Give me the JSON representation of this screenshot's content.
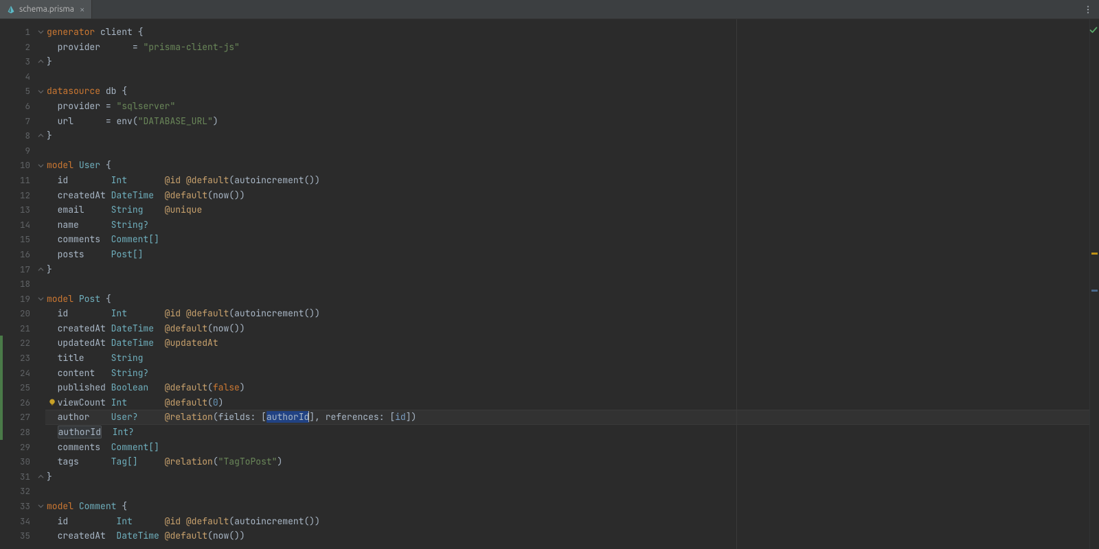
{
  "tab": {
    "filename": "schema.prisma"
  },
  "gutter": {
    "start": 1,
    "end": 35
  },
  "fold": {
    "1": "open",
    "3": "close",
    "5": "open",
    "8": "close",
    "10": "open",
    "17": "close",
    "19": "open",
    "31": "close",
    "33": "open"
  },
  "changes": {
    "22": "mod",
    "23": "mod",
    "24": "mod",
    "25": "mod",
    "26": "mod",
    "27": "mod",
    "28": "mod"
  },
  "cursor_line": 27,
  "intention_bulb_line": 26,
  "code": {
    "1": [
      [
        "kw",
        "generator"
      ],
      [
        "sp",
        " "
      ],
      [
        "id",
        "client"
      ],
      [
        "sp",
        " "
      ],
      [
        "pun",
        "{"
      ]
    ],
    "2": [
      [
        "sp",
        "  "
      ],
      [
        "id",
        "provider"
      ],
      [
        "sp",
        "      "
      ],
      [
        "pun",
        "= "
      ],
      [
        "str",
        "\"prisma-client-js\""
      ]
    ],
    "3": [
      [
        "pun",
        "}"
      ]
    ],
    "4": [],
    "5": [
      [
        "kw",
        "datasource"
      ],
      [
        "sp",
        " "
      ],
      [
        "id",
        "db"
      ],
      [
        "sp",
        " "
      ],
      [
        "pun",
        "{"
      ]
    ],
    "6": [
      [
        "sp",
        "  "
      ],
      [
        "id",
        "provider"
      ],
      [
        "sp",
        " "
      ],
      [
        "pun",
        "= "
      ],
      [
        "str",
        "\"sqlserver\""
      ]
    ],
    "7": [
      [
        "sp",
        "  "
      ],
      [
        "id",
        "url"
      ],
      [
        "sp",
        "      "
      ],
      [
        "pun",
        "= "
      ],
      [
        "fn",
        "env"
      ],
      [
        "pun",
        "("
      ],
      [
        "str",
        "\"DATABASE_URL\""
      ],
      [
        "pun",
        ")"
      ]
    ],
    "8": [
      [
        "pun",
        "}"
      ]
    ],
    "9": [],
    "10": [
      [
        "kw",
        "model"
      ],
      [
        "sp",
        " "
      ],
      [
        "ty",
        "User"
      ],
      [
        "sp",
        " "
      ],
      [
        "pun",
        "{"
      ]
    ],
    "11": [
      [
        "sp",
        "  "
      ],
      [
        "id",
        "id"
      ],
      [
        "sp",
        "        "
      ],
      [
        "ty",
        "Int"
      ],
      [
        "sp",
        "       "
      ],
      [
        "at",
        "@id"
      ],
      [
        "sp",
        " "
      ],
      [
        "at",
        "@default"
      ],
      [
        "pun",
        "("
      ],
      [
        "fn",
        "autoincrement"
      ],
      [
        "pun",
        "())"
      ]
    ],
    "12": [
      [
        "sp",
        "  "
      ],
      [
        "id",
        "createdAt"
      ],
      [
        "sp",
        " "
      ],
      [
        "ty",
        "DateTime"
      ],
      [
        "sp",
        "  "
      ],
      [
        "at",
        "@default"
      ],
      [
        "pun",
        "("
      ],
      [
        "fn",
        "now"
      ],
      [
        "pun",
        "())"
      ]
    ],
    "13": [
      [
        "sp",
        "  "
      ],
      [
        "id",
        "email"
      ],
      [
        "sp",
        "     "
      ],
      [
        "ty",
        "String"
      ],
      [
        "sp",
        "    "
      ],
      [
        "at",
        "@unique"
      ]
    ],
    "14": [
      [
        "sp",
        "  "
      ],
      [
        "id",
        "name"
      ],
      [
        "sp",
        "      "
      ],
      [
        "ty",
        "String?"
      ]
    ],
    "15": [
      [
        "sp",
        "  "
      ],
      [
        "id",
        "comments"
      ],
      [
        "sp",
        "  "
      ],
      [
        "ty",
        "Comment[]"
      ]
    ],
    "16": [
      [
        "sp",
        "  "
      ],
      [
        "id",
        "posts"
      ],
      [
        "sp",
        "     "
      ],
      [
        "ty",
        "Post[]"
      ]
    ],
    "17": [
      [
        "pun",
        "}"
      ]
    ],
    "18": [],
    "19": [
      [
        "kw",
        "model"
      ],
      [
        "sp",
        " "
      ],
      [
        "ty",
        "Post"
      ],
      [
        "sp",
        " "
      ],
      [
        "pun",
        "{"
      ]
    ],
    "20": [
      [
        "sp",
        "  "
      ],
      [
        "id",
        "id"
      ],
      [
        "sp",
        "        "
      ],
      [
        "ty",
        "Int"
      ],
      [
        "sp",
        "       "
      ],
      [
        "at",
        "@id"
      ],
      [
        "sp",
        " "
      ],
      [
        "at",
        "@default"
      ],
      [
        "pun",
        "("
      ],
      [
        "fn",
        "autoincrement"
      ],
      [
        "pun",
        "())"
      ]
    ],
    "21": [
      [
        "sp",
        "  "
      ],
      [
        "id",
        "createdAt"
      ],
      [
        "sp",
        " "
      ],
      [
        "ty",
        "DateTime"
      ],
      [
        "sp",
        "  "
      ],
      [
        "at",
        "@default"
      ],
      [
        "pun",
        "("
      ],
      [
        "fn",
        "now"
      ],
      [
        "pun",
        "())"
      ]
    ],
    "22": [
      [
        "sp",
        "  "
      ],
      [
        "id",
        "updatedAt"
      ],
      [
        "sp",
        " "
      ],
      [
        "ty",
        "DateTime"
      ],
      [
        "sp",
        "  "
      ],
      [
        "at",
        "@updatedAt"
      ]
    ],
    "23": [
      [
        "sp",
        "  "
      ],
      [
        "id",
        "title"
      ],
      [
        "sp",
        "     "
      ],
      [
        "ty",
        "String"
      ]
    ],
    "24": [
      [
        "sp",
        "  "
      ],
      [
        "id",
        "content"
      ],
      [
        "sp",
        "   "
      ],
      [
        "ty",
        "String?"
      ]
    ],
    "25": [
      [
        "sp",
        "  "
      ],
      [
        "id",
        "published"
      ],
      [
        "sp",
        " "
      ],
      [
        "ty",
        "Boolean"
      ],
      [
        "sp",
        "   "
      ],
      [
        "at",
        "@default"
      ],
      [
        "pun",
        "("
      ],
      [
        "bool",
        "false"
      ],
      [
        "pun",
        ")"
      ]
    ],
    "26": [
      [
        "sp",
        "  "
      ],
      [
        "id",
        "viewCount"
      ],
      [
        "sp",
        " "
      ],
      [
        "ty",
        "Int"
      ],
      [
        "sp",
        "       "
      ],
      [
        "at",
        "@default"
      ],
      [
        "pun",
        "("
      ],
      [
        "num",
        "0"
      ],
      [
        "pun",
        ")"
      ]
    ],
    "27": [
      [
        "sp",
        "  "
      ],
      [
        "id",
        "author"
      ],
      [
        "sp",
        "    "
      ],
      [
        "ty",
        "User?"
      ],
      [
        "sp",
        "     "
      ],
      [
        "at",
        "@relation"
      ],
      [
        "pun",
        "("
      ],
      [
        "id",
        "fields"
      ],
      [
        "pun",
        ": ["
      ],
      [
        "sel",
        "authorId"
      ],
      [
        "caret",
        ""
      ],
      [
        "pun",
        "], "
      ],
      [
        "id",
        "references"
      ],
      [
        "pun",
        ": ["
      ],
      [
        "ref",
        "id"
      ],
      [
        "pun",
        "])"
      ]
    ],
    "28": [
      [
        "sp",
        "  "
      ],
      [
        "usage",
        "authorId"
      ],
      [
        "sp",
        "  "
      ],
      [
        "ty",
        "Int?"
      ]
    ],
    "29": [
      [
        "sp",
        "  "
      ],
      [
        "id",
        "comments"
      ],
      [
        "sp",
        "  "
      ],
      [
        "ty",
        "Comment[]"
      ]
    ],
    "30": [
      [
        "sp",
        "  "
      ],
      [
        "id",
        "tags"
      ],
      [
        "sp",
        "      "
      ],
      [
        "ty",
        "Tag[]"
      ],
      [
        "sp",
        "     "
      ],
      [
        "at",
        "@relation"
      ],
      [
        "pun",
        "("
      ],
      [
        "str",
        "\"TagToPost\""
      ],
      [
        "pun",
        ")"
      ]
    ],
    "31": [
      [
        "pun",
        "}"
      ]
    ],
    "32": [],
    "33": [
      [
        "kw",
        "model"
      ],
      [
        "sp",
        " "
      ],
      [
        "ty",
        "Comment"
      ],
      [
        "sp",
        " "
      ],
      [
        "pun",
        "{"
      ]
    ],
    "34": [
      [
        "sp",
        "  "
      ],
      [
        "id",
        "id"
      ],
      [
        "sp",
        "         "
      ],
      [
        "ty",
        "Int"
      ],
      [
        "sp",
        "      "
      ],
      [
        "at",
        "@id"
      ],
      [
        "sp",
        " "
      ],
      [
        "at",
        "@default"
      ],
      [
        "pun",
        "("
      ],
      [
        "fn",
        "autoincrement"
      ],
      [
        "pun",
        "())"
      ]
    ],
    "35": [
      [
        "sp",
        "  "
      ],
      [
        "id",
        "createdAt"
      ],
      [
        "sp",
        "  "
      ],
      [
        "ty",
        "DateTime"
      ],
      [
        "sp",
        " "
      ],
      [
        "at",
        "@default"
      ],
      [
        "pun",
        "("
      ],
      [
        "fn",
        "now"
      ],
      [
        "pun",
        "())"
      ]
    ]
  },
  "annotations": [
    {
      "kind": "warn",
      "topPct": 44
    },
    {
      "kind": "info",
      "topPct": 51
    }
  ]
}
